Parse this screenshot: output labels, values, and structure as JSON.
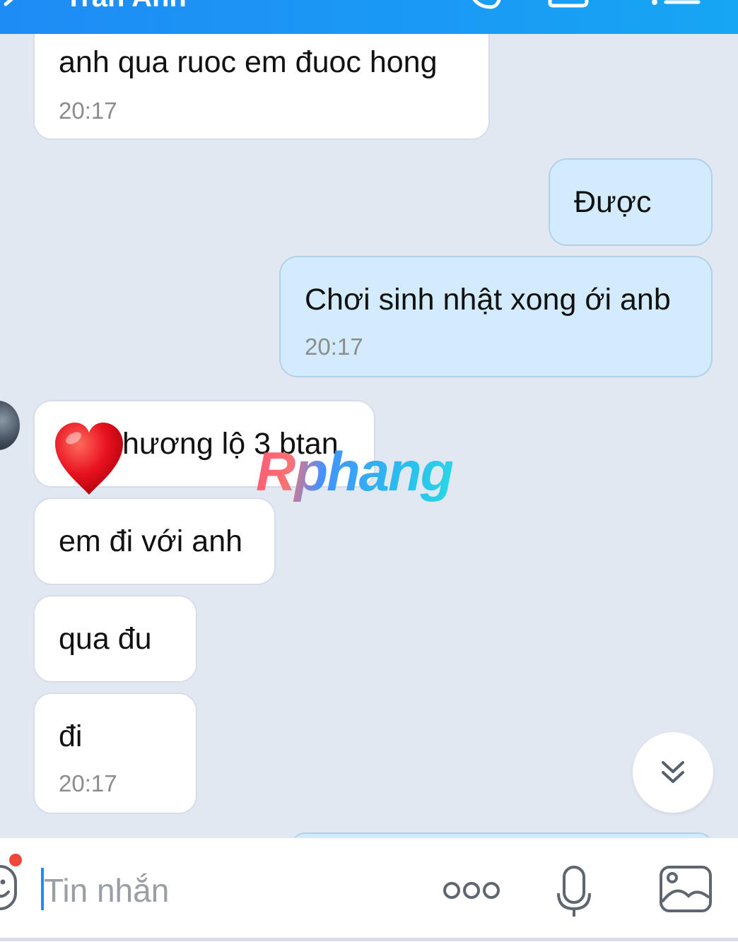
{
  "header": {
    "title": "Trần Anh"
  },
  "messages": [
    {
      "direction": "in",
      "text": "anh qua ruoc em đuoc hong",
      "time": "20:17"
    },
    {
      "direction": "out",
      "text": "Được",
      "time": ""
    },
    {
      "direction": "out",
      "text": "Chơi sinh nhật xong ới anb",
      "time": "20:17"
    },
    {
      "direction": "in",
      "text": "hương lộ 3 btan",
      "time": ""
    },
    {
      "direction": "in",
      "text": "em đi với anh",
      "time": ""
    },
    {
      "direction": "in",
      "text": "qua đu",
      "time": ""
    },
    {
      "direction": "in",
      "text": "đi",
      "time": "20:17"
    }
  ],
  "watermark": "Rphang",
  "composer": {
    "placeholder": "Tin nhắn"
  },
  "colors": {
    "header": "#1e8cf5",
    "chat_background": "#e2e8f2",
    "incoming_bubble": "#ffffff",
    "outgoing_bubble": "#d3ecfd",
    "time_text": "#8c8c8c",
    "notification_dot": "#f0463c",
    "caret": "#1a8cf6"
  },
  "icons": {
    "back": "chevron-left-icon",
    "call": "phone-icon",
    "video": "video-camera-icon",
    "menu": "list-menu-icon",
    "scroll_down": "double-chevron-down-icon",
    "emoji": "sticker-face-icon",
    "more": "more-options-icon",
    "voice": "microphone-icon",
    "image": "image-icon",
    "reaction": "red-heart-icon"
  }
}
